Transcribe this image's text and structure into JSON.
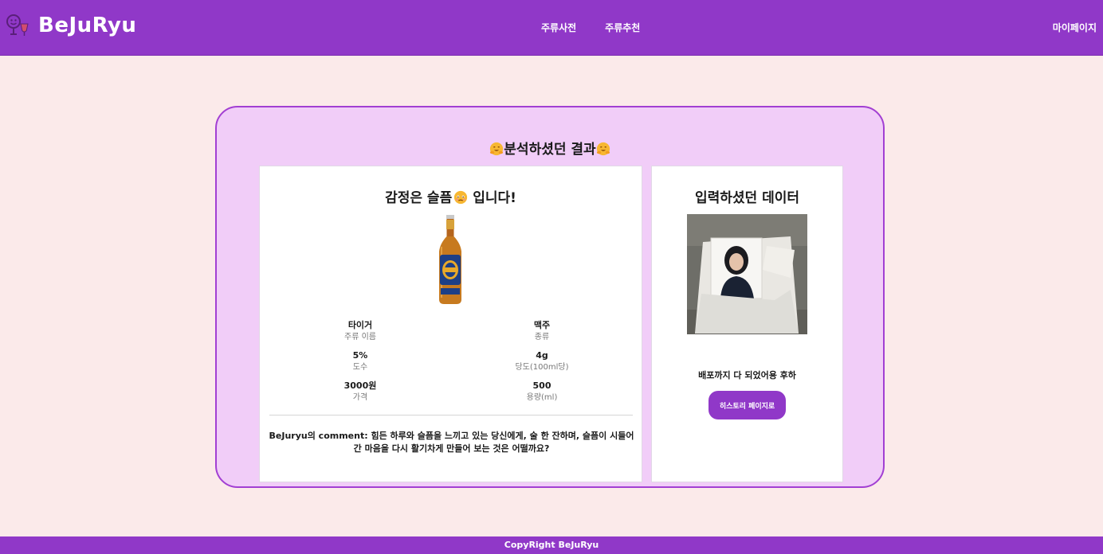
{
  "header": {
    "logo_text": "BeJuRyu",
    "nav": [
      {
        "label": "주류사전"
      },
      {
        "label": "주류추천"
      }
    ],
    "mypage_label": "마이페이지"
  },
  "result": {
    "title": "분석하셨던 결과",
    "emotion_prefix": "감정은 슬픔",
    "emotion_suffix": "입니다!",
    "drink": {
      "name": "타이거",
      "name_label": "주류 이름",
      "type": "맥주",
      "type_label": "종류",
      "abv": "5%",
      "abv_label": "도수",
      "sugar": "4g",
      "sugar_label": "당도(100ml당)",
      "price": "3000원",
      "price_label": "가격",
      "volume": "500",
      "volume_label": "용량(ml)"
    },
    "comment": "BeJuryu의 comment: 힘든 하루와 슬픔을 느끼고 있는 당신에게, 술 한 잔하며, 슬픔이 시들어간 마음을 다시 활기차게 만들어 보는 것은 어떨까요?"
  },
  "input": {
    "title": "입력하셨던 데이터",
    "deploy_text": "배포까지 다 되었어용 후하",
    "history_button": "히스토리 페이지로"
  },
  "footer": {
    "text": "CopyRight BeJuRyu"
  },
  "colors": {
    "brand": "#9038c8",
    "panel_bg": "#f1cdf8",
    "page_bg": "#fbeaea"
  }
}
